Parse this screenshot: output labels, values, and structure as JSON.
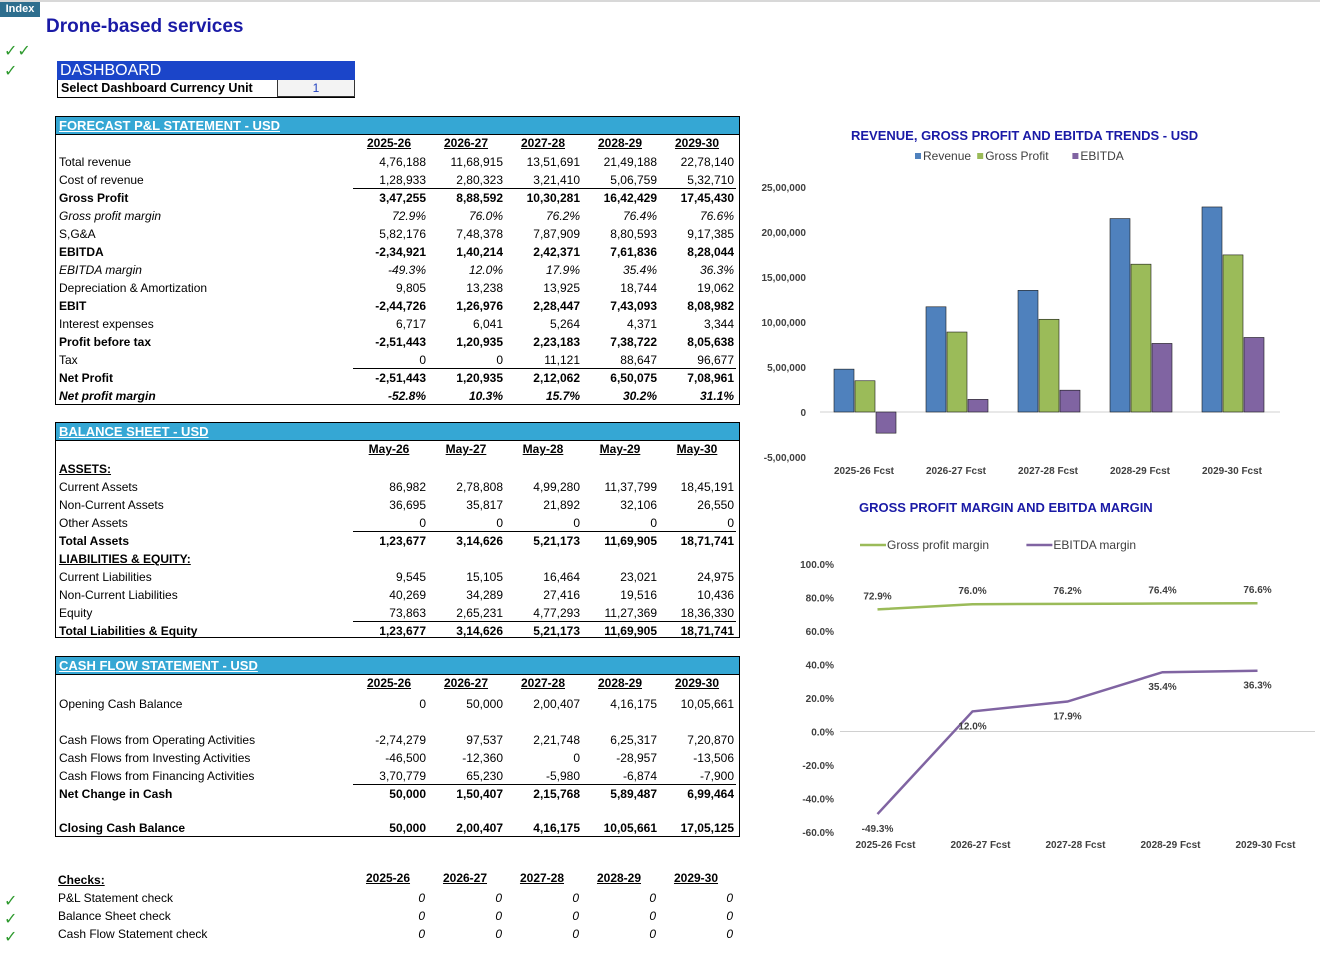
{
  "app": {
    "index_button": "Index",
    "title": "Drone-based services"
  },
  "dashboard": {
    "heading": "DASHBOARD",
    "currency_label": "Select Dashboard Currency Unit",
    "currency_value": "1"
  },
  "pl": {
    "heading": "FORECAST P&L STATEMENT - USD",
    "years": [
      "2025-26",
      "2026-27",
      "2027-28",
      "2028-29",
      "2029-30"
    ],
    "rows": [
      {
        "label": "Total revenue",
        "values": [
          "4,76,188",
          "11,68,915",
          "13,51,691",
          "21,49,188",
          "22,78,140"
        ]
      },
      {
        "label": "Cost of revenue",
        "values": [
          "1,28,933",
          "2,80,323",
          "3,21,410",
          "5,06,759",
          "5,32,710"
        ]
      },
      {
        "label": "Gross Profit",
        "values": [
          "3,47,255",
          "8,88,592",
          "10,30,281",
          "16,42,429",
          "17,45,430"
        ]
      },
      {
        "label": "Gross profit margin",
        "values": [
          "72.9%",
          "76.0%",
          "76.2%",
          "76.4%",
          "76.6%"
        ]
      },
      {
        "label": "S,G&A",
        "values": [
          "5,82,176",
          "7,48,378",
          "7,87,909",
          "8,80,593",
          "9,17,385"
        ]
      },
      {
        "label": "EBITDA",
        "values": [
          "-2,34,921",
          "1,40,214",
          "2,42,371",
          "7,61,836",
          "8,28,044"
        ]
      },
      {
        "label": "EBITDA margin",
        "values": [
          "-49.3%",
          "12.0%",
          "17.9%",
          "35.4%",
          "36.3%"
        ]
      },
      {
        "label": "Depreciation & Amortization",
        "values": [
          "9,805",
          "13,238",
          "13,925",
          "18,744",
          "19,062"
        ]
      },
      {
        "label": "EBIT",
        "values": [
          "-2,44,726",
          "1,26,976",
          "2,28,447",
          "7,43,093",
          "8,08,982"
        ]
      },
      {
        "label": "Interest expenses",
        "values": [
          "6,717",
          "6,041",
          "5,264",
          "4,371",
          "3,344"
        ]
      },
      {
        "label": "Profit before tax",
        "values": [
          "-2,51,443",
          "1,20,935",
          "2,23,183",
          "7,38,722",
          "8,05,638"
        ]
      },
      {
        "label": "Tax",
        "values": [
          "0",
          "0",
          "11,121",
          "88,647",
          "96,677"
        ]
      },
      {
        "label": "Net Profit",
        "values": [
          "-2,51,443",
          "1,20,935",
          "2,12,062",
          "6,50,075",
          "7,08,961"
        ]
      },
      {
        "label": "Net profit margin",
        "values": [
          "-52.8%",
          "10.3%",
          "15.7%",
          "30.2%",
          "31.1%"
        ]
      }
    ]
  },
  "bs": {
    "heading": "BALANCE SHEET - USD",
    "dates": [
      "May-26",
      "May-27",
      "May-28",
      "May-29",
      "May-30"
    ],
    "assets_label": "ASSETS:",
    "liab_label": "LIABILITIES & EQUITY:",
    "assets": [
      {
        "label": "Current Assets",
        "values": [
          "86,982",
          "2,78,808",
          "4,99,280",
          "11,37,799",
          "18,45,191"
        ]
      },
      {
        "label": "Non-Current Assets",
        "values": [
          "36,695",
          "35,817",
          "21,892",
          "32,106",
          "26,550"
        ]
      },
      {
        "label": "Other Assets",
        "values": [
          "0",
          "0",
          "0",
          "0",
          "0"
        ]
      },
      {
        "label": "Total Assets",
        "values": [
          "1,23,677",
          "3,14,626",
          "5,21,173",
          "11,69,905",
          "18,71,741"
        ]
      }
    ],
    "liabilities": [
      {
        "label": "Current Liabilities",
        "values": [
          "9,545",
          "15,105",
          "16,464",
          "23,021",
          "24,975"
        ]
      },
      {
        "label": "Non-Current Liabilities",
        "values": [
          "40,269",
          "34,289",
          "27,416",
          "19,516",
          "10,436"
        ]
      },
      {
        "label": "Equity",
        "values": [
          "73,863",
          "2,65,231",
          "4,77,293",
          "11,27,369",
          "18,36,330"
        ]
      },
      {
        "label": "Total Liabilities & Equity",
        "values": [
          "1,23,677",
          "3,14,626",
          "5,21,173",
          "11,69,905",
          "18,71,741"
        ]
      }
    ]
  },
  "cf": {
    "heading": "CASH FLOW STATEMENT -  USD",
    "years": [
      "2025-26",
      "2026-27",
      "2027-28",
      "2028-29",
      "2029-30"
    ],
    "opening": {
      "label": "Opening Cash Balance",
      "values": [
        "0",
        "50,000",
        "2,00,407",
        "4,16,175",
        "10,05,661"
      ]
    },
    "flows": [
      {
        "label": "Cash Flows from Operating Activities",
        "values": [
          "-2,74,279",
          "97,537",
          "2,21,748",
          "6,25,317",
          "7,20,870"
        ]
      },
      {
        "label": "Cash Flows from Investing Activities",
        "values": [
          "-46,500",
          "-12,360",
          "0",
          "-28,957",
          "-13,506"
        ]
      },
      {
        "label": "Cash Flows from Financing Activities",
        "values": [
          "3,70,779",
          "65,230",
          "-5,980",
          "-6,874",
          "-7,900"
        ]
      },
      {
        "label": "Net Change in Cash",
        "values": [
          "50,000",
          "1,50,407",
          "2,15,768",
          "5,89,487",
          "6,99,464"
        ]
      }
    ],
    "closing": {
      "label": "Closing Cash Balance",
      "values": [
        "50,000",
        "2,00,407",
        "4,16,175",
        "10,05,661",
        "17,05,125"
      ]
    }
  },
  "checks": {
    "heading": "Checks:",
    "years": [
      "2025-26",
      "2026-27",
      "2027-28",
      "2028-29",
      "2029-30"
    ],
    "rows": [
      {
        "label": "P&L Statement check",
        "values": [
          "0",
          "0",
          "0",
          "0",
          "0"
        ]
      },
      {
        "label": "Balance Sheet check",
        "values": [
          "0",
          "0",
          "0",
          "0",
          "0"
        ]
      },
      {
        "label": "Cash Flow Statement check",
        "values": [
          "0",
          "0",
          "0",
          "0",
          "0"
        ]
      }
    ]
  },
  "chart_data": [
    {
      "type": "bar",
      "title": "REVENUE, GROSS PROFIT AND EBITDA TRENDS - USD",
      "categories": [
        "2025-26 Fcst",
        "2026-27 Fcst",
        "2027-28 Fcst",
        "2028-29 Fcst",
        "2029-30 Fcst"
      ],
      "series": [
        {
          "name": "Revenue",
          "color": "#4f81bd",
          "values": [
            476188,
            1168915,
            1351691,
            2149188,
            2278140
          ]
        },
        {
          "name": "Gross Profit",
          "color": "#9bbb59",
          "values": [
            347255,
            888592,
            1030281,
            1642429,
            1745430
          ]
        },
        {
          "name": "EBITDA",
          "color": "#8064a2",
          "values": [
            -234921,
            140214,
            242371,
            761836,
            828044
          ]
        }
      ],
      "ylim": [
        -500000,
        2500000
      ],
      "yticks": [
        "25,00,000",
        "20,00,000",
        "15,00,000",
        "10,00,000",
        "5,00,000",
        "0",
        "-5,00,000"
      ],
      "legend": "top"
    },
    {
      "type": "line",
      "title": "GROSS PROFIT MARGIN AND EBITDA MARGIN",
      "categories": [
        "2025-26 Fcst",
        "2026-27 Fcst",
        "2027-28 Fcst",
        "2028-29 Fcst",
        "2029-30 Fcst"
      ],
      "series": [
        {
          "name": "Gross profit margin",
          "color": "#9bbb59",
          "values": [
            72.9,
            76.0,
            76.2,
            76.4,
            76.6
          ],
          "labels": [
            "72.9%",
            "76.0%",
            "76.2%",
            "76.4%",
            "76.6%"
          ]
        },
        {
          "name": "EBITDA margin",
          "color": "#8064a2",
          "values": [
            -49.3,
            12.0,
            17.9,
            35.4,
            36.3
          ],
          "labels": [
            "-49.3%",
            "12.0%",
            "17.9%",
            "35.4%",
            "36.3%"
          ]
        }
      ],
      "ylim": [
        -60,
        100
      ],
      "yticks": [
        "100.0%",
        "80.0%",
        "60.0%",
        "40.0%",
        "20.0%",
        "0.0%",
        "-20.0%",
        "-40.0%",
        "-60.0%"
      ],
      "legend": "top"
    }
  ]
}
